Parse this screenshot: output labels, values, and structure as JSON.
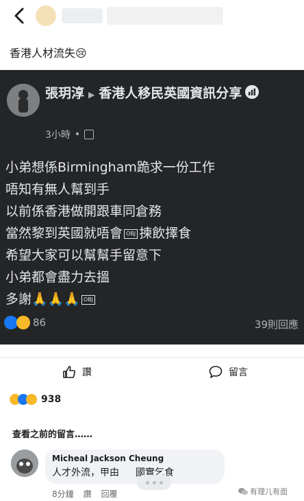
{
  "header": {
    "post_caption": "香港人材流失😢"
  },
  "post": {
    "author": "張玥淳",
    "group": "香港人移民英國資訊分享",
    "time": "3小時",
    "lines": [
      "小弟想係Birmingham跪求一份工作",
      "唔知有無人幫到手",
      "以前係香港做開跟車同倉務",
      "當然黎到英國就唔會",
      "揀飲擇食",
      "希望大家可以幫幫手留意下",
      "小弟都會盡力去搵",
      "多謝🙏🙏🙏"
    ],
    "obj_label": "OBJ",
    "reaction_count": "86",
    "comment_count": "39則回應"
  },
  "actions": {
    "like_label": "讚",
    "comment_label": "留言"
  },
  "outer": {
    "reaction_count": "938",
    "view_previous": "查看之前的留言……"
  },
  "comment": {
    "name": "Micheal Jackson Cheung",
    "text_a": "人才外流，甲由",
    "text_b": "國實乞食",
    "time": "8分鐘",
    "like": "讚",
    "reply": "回覆"
  },
  "watermark": "有理儿有面",
  "colors": {
    "card_bg": "#242526",
    "like_blue": "#1877f2",
    "emoji_yellow": "#f7b928"
  },
  "icons": [
    "back-chevron-icon",
    "insights-icon",
    "globe-icon",
    "thumb-up-icon",
    "comment-icon"
  ]
}
